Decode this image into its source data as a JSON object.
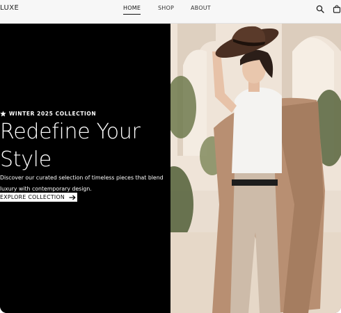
{
  "brand": {
    "logo": "LUXE"
  },
  "nav": {
    "items": [
      {
        "label": "HOME",
        "active": true
      },
      {
        "label": "SHOP",
        "active": false
      },
      {
        "label": "ABOUT",
        "active": false
      }
    ]
  },
  "header_icons": [
    "search-icon",
    "shopping-bag-icon"
  ],
  "hero": {
    "eyebrow": "WINTER 2025 COLLECTION",
    "eyebrow_icon": "star-icon",
    "headline_line1": "Redefine Your",
    "headline_line2": "Style",
    "description": "Discover our curated selection of timeless pieces that blend luxury with contemporary design.",
    "cta_label": "EXPLORE COLLECTION",
    "cta_icon": "arrow-right-icon",
    "image": "fashion-model-photo"
  },
  "colors": {
    "hero_bg": "#000000",
    "header_bg": "#f7f7f7",
    "text_light": "#ffffff",
    "text_dark": "#111111"
  }
}
